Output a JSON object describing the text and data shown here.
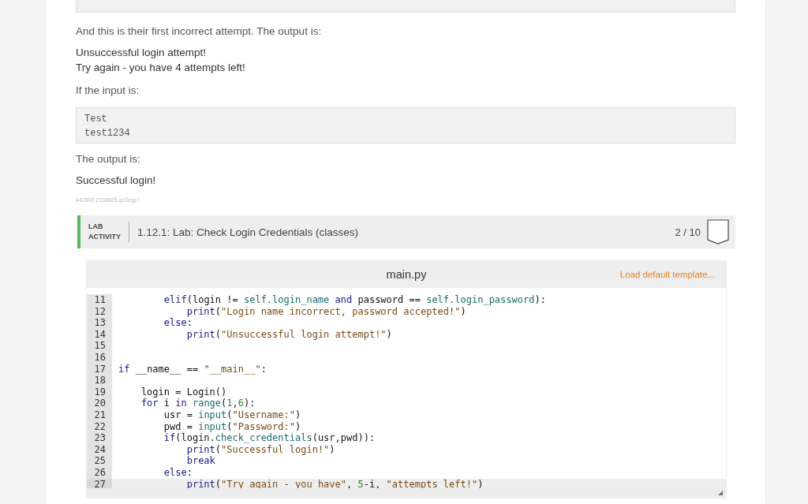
{
  "description": {
    "intro": "And this is their first incorrect attempt. The output is:",
    "output_1": [
      "Unsuccessful login attempt!",
      "Try again - you have 4 attempts left!"
    ],
    "input_intro": "If the input is:",
    "input_lines": [
      "Test",
      "test1234"
    ],
    "output_intro": "The output is:",
    "output_2": [
      "Successful login!"
    ],
    "id": "442800.2138828.qx3zqy7"
  },
  "lab": {
    "label": [
      "LAB",
      "ACTIVITY"
    ],
    "title": "1.12.1: Lab: Check Login Credentials (classes)",
    "score": "2 / 10"
  },
  "editor": {
    "filename": "main.py",
    "template_link": "Load default template...",
    "lines": [
      {
        "number": "11",
        "active": false,
        "segments": [
          {
            "kind": "kw",
            "text": "        elif"
          },
          {
            "kind": "plain",
            "text": "(login != "
          },
          {
            "kind": "fn",
            "text": "self.login_name"
          },
          {
            "kind": "kw",
            "text": " and"
          },
          {
            "kind": "plain",
            "text": " password == "
          },
          {
            "kind": "fn",
            "text": "self.login_password"
          },
          {
            "kind": "plain",
            "text": "):"
          }
        ]
      },
      {
        "number": "12",
        "active": false,
        "segments": [
          {
            "kind": "kw",
            "text": "            print"
          },
          {
            "kind": "plain",
            "text": "("
          },
          {
            "kind": "str",
            "text": "\"Login name incorrect, password accepted!\""
          },
          {
            "kind": "plain",
            "text": ")"
          }
        ]
      },
      {
        "number": "13",
        "active": false,
        "segments": [
          {
            "kind": "kw",
            "text": "        else"
          },
          {
            "kind": "plain",
            "text": ":"
          }
        ]
      },
      {
        "number": "14",
        "active": false,
        "segments": [
          {
            "kind": "kw",
            "text": "            print"
          },
          {
            "kind": "plain",
            "text": "("
          },
          {
            "kind": "str",
            "text": "\"Unsuccessful login attempt!\""
          },
          {
            "kind": "plain",
            "text": ")"
          }
        ]
      },
      {
        "number": "15",
        "active": false
      },
      {
        "number": "16",
        "active": false
      },
      {
        "number": "17",
        "active": false,
        "segments": [
          {
            "kind": "kw",
            "text": "if"
          },
          {
            "kind": "plain",
            "text": " __name__ == "
          },
          {
            "kind": "str",
            "text": "\"__main__\""
          },
          {
            "kind": "plain",
            "text": ":"
          }
        ]
      },
      {
        "number": "18",
        "active": false
      },
      {
        "number": "19",
        "active": false,
        "segments": [
          {
            "kind": "plain",
            "text": "    login = Login()"
          }
        ]
      },
      {
        "number": "20",
        "active": false,
        "segments": [
          {
            "kind": "kw",
            "text": "    for"
          },
          {
            "kind": "plain",
            "text": " i "
          },
          {
            "kind": "kw",
            "text": "in"
          },
          {
            "kind": "fn",
            "text": " range"
          },
          {
            "kind": "plain",
            "text": "("
          },
          {
            "kind": "num",
            "text": "1"
          },
          {
            "kind": "plain",
            "text": ","
          },
          {
            "kind": "num",
            "text": "6"
          },
          {
            "kind": "plain",
            "text": "):"
          }
        ]
      },
      {
        "number": "21",
        "active": false,
        "segments": [
          {
            "kind": "plain",
            "text": "        usr = "
          },
          {
            "kind": "fn",
            "text": "input"
          },
          {
            "kind": "plain",
            "text": "("
          },
          {
            "kind": "str",
            "text": "\"Username:\""
          },
          {
            "kind": "plain",
            "text": ")"
          }
        ]
      },
      {
        "number": "22",
        "active": false,
        "segments": [
          {
            "kind": "plain",
            "text": "        pwd = "
          },
          {
            "kind": "fn",
            "text": "input"
          },
          {
            "kind": "plain",
            "text": "("
          },
          {
            "kind": "str",
            "text": "\"Password:\""
          },
          {
            "kind": "plain",
            "text": ")"
          }
        ]
      },
      {
        "number": "23",
        "active": false,
        "segments": [
          {
            "kind": "kw",
            "text": "        if"
          },
          {
            "kind": "plain",
            "text": "(login."
          },
          {
            "kind": "fn",
            "text": "check_credentials"
          },
          {
            "kind": "plain",
            "text": "(usr,pwd)):"
          }
        ]
      },
      {
        "number": "24",
        "active": false,
        "segments": [
          {
            "kind": "kw",
            "text": "            print"
          },
          {
            "kind": "plain",
            "text": "("
          },
          {
            "kind": "str",
            "text": "\"Successful login!\""
          },
          {
            "kind": "plain",
            "text": ")"
          }
        ]
      },
      {
        "number": "25",
        "active": false,
        "segments": [
          {
            "kind": "kw",
            "text": "            break"
          }
        ]
      },
      {
        "number": "26",
        "active": false,
        "segments": [
          {
            "kind": "kw",
            "text": "        else"
          },
          {
            "kind": "plain",
            "text": ":"
          }
        ]
      },
      {
        "number": "27",
        "active": true,
        "segments": [
          {
            "kind": "kw",
            "text": "            print"
          },
          {
            "kind": "plain",
            "text": "("
          },
          {
            "kind": "str",
            "text": "\"Try again - you have\""
          },
          {
            "kind": "plain",
            "text": ", "
          },
          {
            "kind": "num",
            "text": "5"
          },
          {
            "kind": "plain",
            "text": "-i, "
          },
          {
            "kind": "str",
            "text": "\"attempts left!\""
          },
          {
            "kind": "plain",
            "text": ")"
          }
        ]
      }
    ]
  }
}
